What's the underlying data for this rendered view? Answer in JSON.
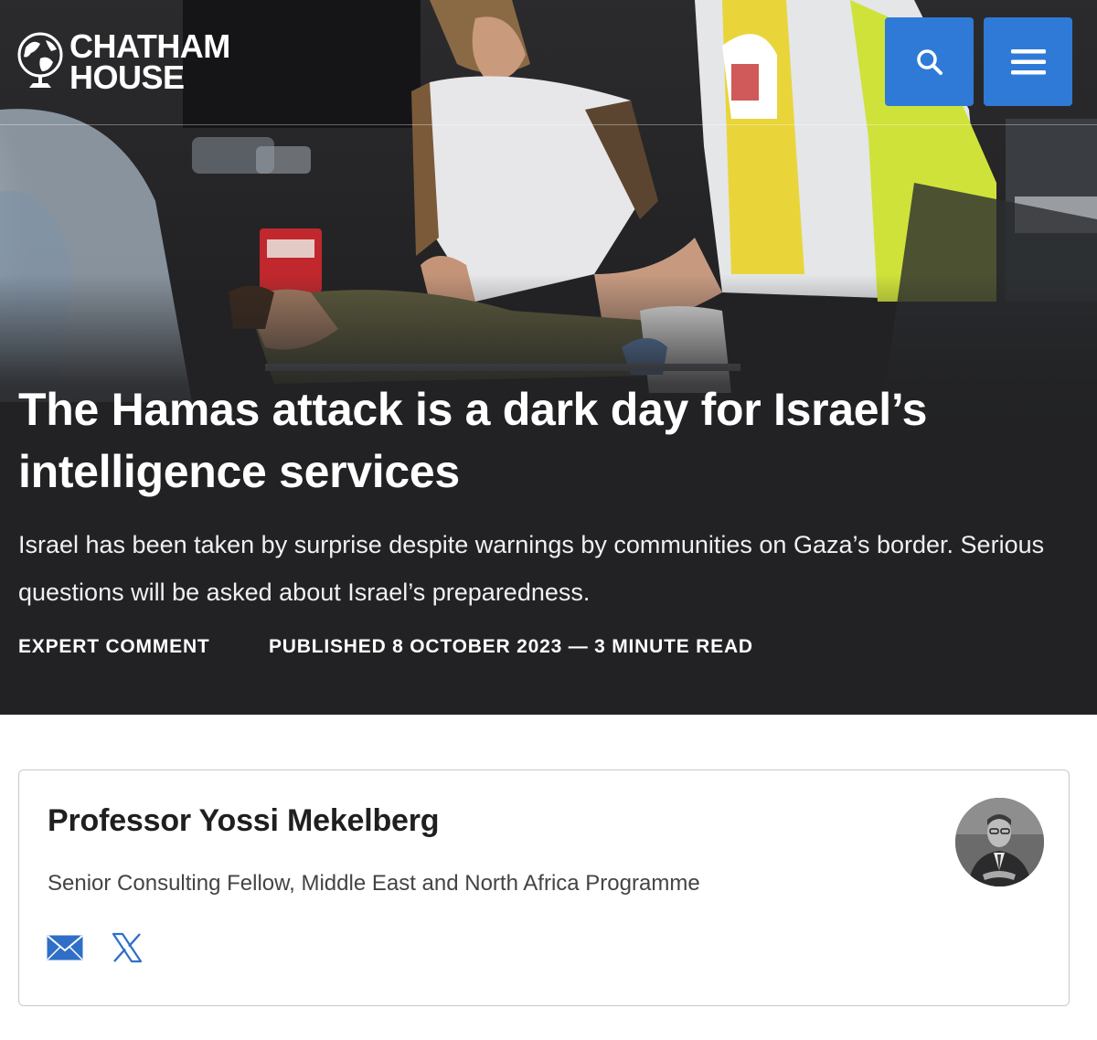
{
  "brand": {
    "name_line1": "CHATHAM",
    "name_line2": "HOUSE"
  },
  "header": {
    "search_icon": "search-icon",
    "menu_icon": "hamburger-menu-icon",
    "accent_color": "#2f7ad6"
  },
  "hero": {
    "title": "The Hamas attack is a dark day for Israel’s intelligence services",
    "summary": "Israel has been taken by surprise despite warnings by communities on Gaza’s border. Serious questions will be asked about Israel’s preparedness.",
    "content_type": "EXPERT COMMENT",
    "published": "PUBLISHED 8 OCTOBER 2023 — 3 MINUTE READ"
  },
  "author": {
    "name": "Professor Yossi Mekelberg",
    "role": "Senior Consulting Fellow, Middle East and North Africa Programme",
    "social": [
      {
        "icon": "email-icon"
      },
      {
        "icon": "x-logo-icon"
      }
    ]
  }
}
